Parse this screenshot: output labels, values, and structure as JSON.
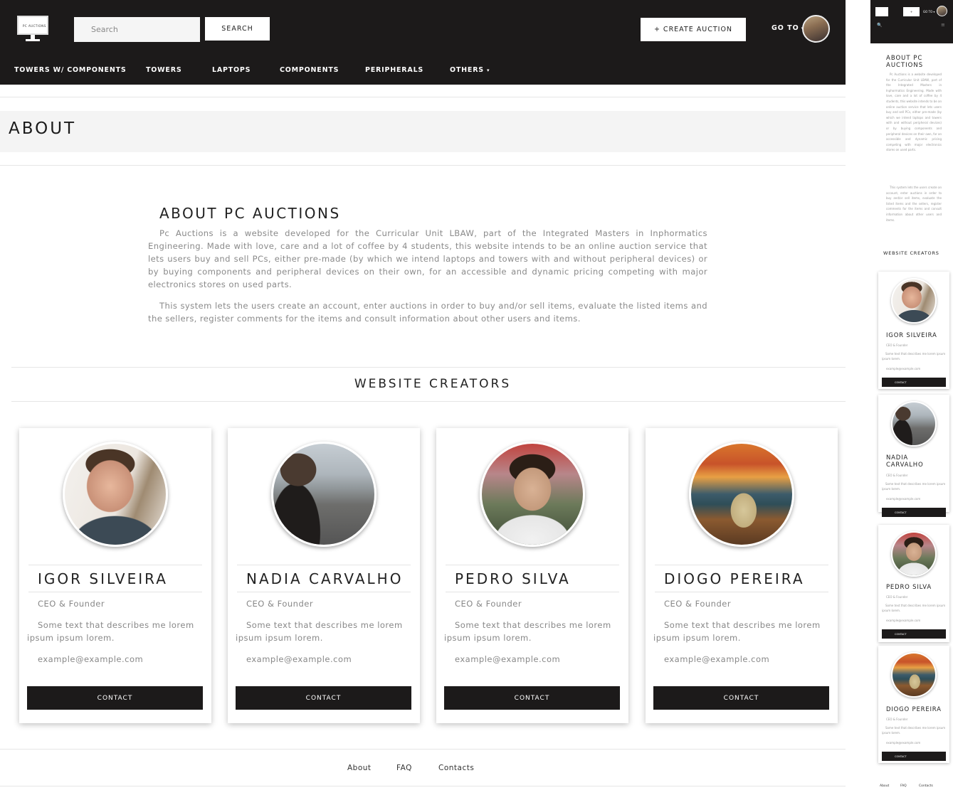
{
  "nav": {
    "logo_text": "PC AUCTIONS",
    "search_placeholder": "Search",
    "search_button": "SEARCH",
    "create_button": "+ CREATE AUCTION",
    "goto_label": "GO TO",
    "goto_caret": "▾",
    "menu": [
      {
        "label": "TOWERS W/ COMPONENTS"
      },
      {
        "label": "TOWERS"
      },
      {
        "label": "LAPTOPS"
      },
      {
        "label": "COMPONENTS"
      },
      {
        "label": "PERIPHERALS"
      },
      {
        "label": "OTHERS"
      }
    ],
    "menu_caret": "▾"
  },
  "page": {
    "heading": "ABOUT",
    "about_title": "ABOUT PC AUCTIONS",
    "paragraph1": "Pc Auctions is a website developed for the Curricular Unit LBAW, part of the Integrated Masters in Inphormatics Engineering. Made with love, care and a lot of coffee by 4 students, this website intends to be an online auction service that lets users buy and sell PCs, either pre-made (by which we intend laptops and towers with and without peripheral devices) or by buying components and peripheral devices on their own, for an accessible and dynamic pricing competing with major electronics stores on used parts.",
    "paragraph2": "This system lets the users create an account, enter auctions in order to buy and/or sell items, evaluate the listed items and the sellers, register comments for the items and consult information about other users and items.",
    "creators_title": "WEBSITE CREATORS"
  },
  "creators": [
    {
      "name": "IGOR SILVEIRA",
      "role": "CEO & Founder",
      "desc": "Some text that describes me lorem ipsum ipsum lorem.",
      "email": "example@example.com",
      "button": "CONTACT"
    },
    {
      "name": "NADIA CARVALHO",
      "role": "CEO & Founder",
      "desc": "Some text that describes me lorem ipsum ipsum lorem.",
      "email": "example@example.com",
      "button": "CONTACT"
    },
    {
      "name": "PEDRO SILVA",
      "role": "CEO & Founder",
      "desc": "Some text that describes me lorem ipsum ipsum lorem.",
      "email": "example@example.com",
      "button": "CONTACT"
    },
    {
      "name": "DIOGO PEREIRA",
      "role": "CEO & Founder",
      "desc": "Some text that describes me lorem ipsum ipsum lorem.",
      "email": "example@example.com",
      "button": "CONTACT"
    }
  ],
  "footer": {
    "links": [
      "About",
      "FAQ",
      "Contacts"
    ]
  },
  "mobile": {
    "search_button": "+",
    "goto_label": "GO TO ▾",
    "search_icon": "🔍",
    "menu_icon": "≡",
    "about_title": "ABOUT PC AUCTIONS",
    "creators_title": "WEBSITE CREATORS",
    "names": [
      "IGOR SILVEIRA",
      "NADIA CARVALHO",
      "PEDRO SILVA",
      "DIOGO PEREIRA"
    ]
  },
  "colors": {
    "nav_bg": "#1c1a1a",
    "band_bg": "#f4f4f4",
    "text_muted": "#8a8a8a"
  }
}
